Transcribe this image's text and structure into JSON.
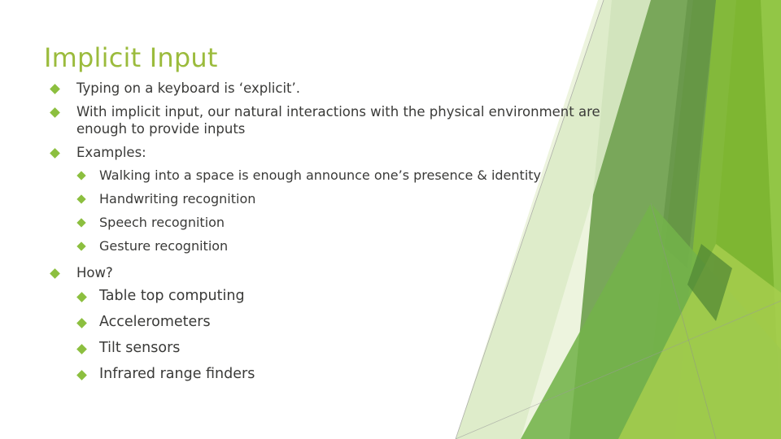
{
  "slide": {
    "title": "Implicit Input",
    "background_color": "#FFFFFF",
    "title_color": "#9BBB3C",
    "body_text_color": "#3A3A38",
    "bullet_color": "#8CBF3F",
    "theme_colors": {
      "dark_green": "#6FA04E",
      "mid_green": "#7DB532",
      "bright_green": "#92C646",
      "light_green": "#A6CE4E",
      "pale_green": "#DCEBC8",
      "very_pale_green": "#EDF4DE",
      "line_gray": "#9A9A9A"
    }
  },
  "content": {
    "bullets": [
      {
        "level": 1,
        "text": "Typing on a keyboard is ‘explicit’."
      },
      {
        "level": 1,
        "text": "With implicit input, our natural interactions with the physical environment are enough to provide inputs"
      },
      {
        "level": 1,
        "text": "Examples:"
      },
      {
        "level": 2,
        "text": "Walking into a space is enough announce one’s presence & identity"
      },
      {
        "level": 2,
        "text": "Handwriting recognition"
      },
      {
        "level": 2,
        "text": "Speech recognition"
      },
      {
        "level": 2,
        "text": "Gesture recognition"
      },
      {
        "level": 1,
        "text": "How?"
      },
      {
        "level": 2,
        "text": "Table top computing"
      },
      {
        "level": 2,
        "text": "Accelerometers"
      },
      {
        "level": 2,
        "text": "Tilt sensors"
      },
      {
        "level": 2,
        "text": "Infrared range finders"
      }
    ]
  }
}
